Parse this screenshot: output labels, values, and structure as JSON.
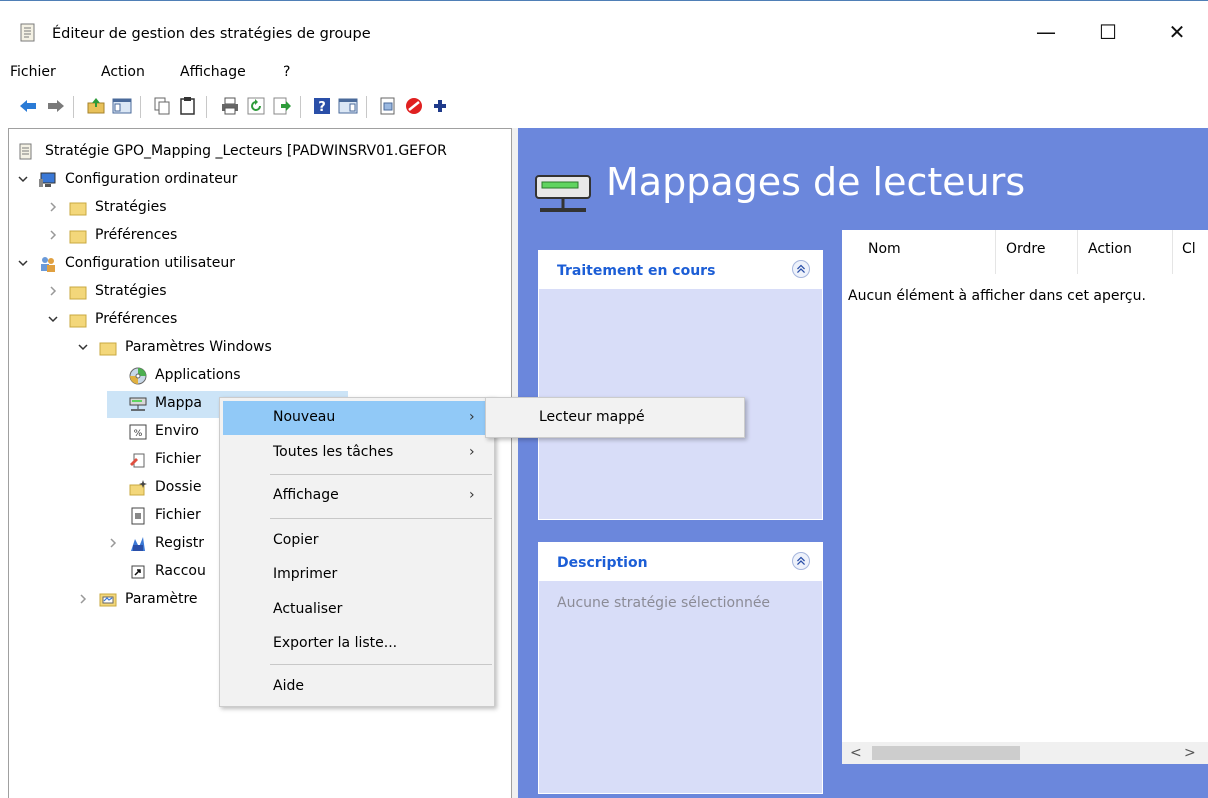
{
  "window": {
    "title": "Éditeur de gestion des stratégies de groupe",
    "minimize_glyph": "—",
    "maximize_glyph": "☐",
    "close_glyph": "✕"
  },
  "menubar": {
    "items": [
      "Fichier",
      "Action",
      "Affichage",
      "?"
    ]
  },
  "toolbar": {
    "icons": [
      "back-arrow-icon",
      "forward-arrow-icon",
      "up-folder-icon",
      "show-hide-tree-icon",
      "copy-icon",
      "paste-icon",
      "print-icon",
      "refresh-icon",
      "export-list-icon",
      "help-icon",
      "show-hide-action-pane-icon",
      "properties-icon",
      "block-icon",
      "add-icon"
    ]
  },
  "tree": {
    "root": "Stratégie GPO_Mapping _Lecteurs [PADWINSRV01.GEFOR",
    "computer_config": "Configuration ordinateur",
    "computer_strategies": "Stratégies",
    "computer_preferences": "Préférences",
    "user_config": "Configuration utilisateur",
    "user_strategies": "Stratégies",
    "user_preferences": "Préférences",
    "windows_settings": "Paramètres Windows",
    "applications": "Applications",
    "drive_mappings": "Mappa",
    "environment": "Enviro",
    "files": "Fichier",
    "folders": "Dossie",
    "ini_files": "Fichier",
    "registry": "Registr",
    "shortcuts": "Raccou",
    "control_panel": "Paramètre"
  },
  "right_pane": {
    "title": "Mappages de lecteurs",
    "processing_panel_title": "Traitement en cours",
    "description_panel_title": "Description",
    "description_text": "Aucune stratégie sélectionnée",
    "columns": [
      "Nom",
      "Ordre",
      "Action",
      "Cl"
    ],
    "empty_message": "Aucun élément à afficher dans cet aperçu.",
    "scroll_left": "<",
    "scroll_right": ">"
  },
  "context_menu": {
    "nouveau": "Nouveau",
    "toutes_taches": "Toutes les tâches",
    "affichage": "Affichage",
    "copier": "Copier",
    "imprimer": "Imprimer",
    "actualiser": "Actualiser",
    "exporter": "Exporter la liste...",
    "aide": "Aide",
    "submenu_arrow": "›"
  },
  "submenu": {
    "lecteur_mappe": "Lecteur mappé"
  },
  "colors": {
    "right_pane_bg": "#6b87dc",
    "panel_title": "#1c5ed6",
    "menu_highlight": "#91c9f7"
  }
}
